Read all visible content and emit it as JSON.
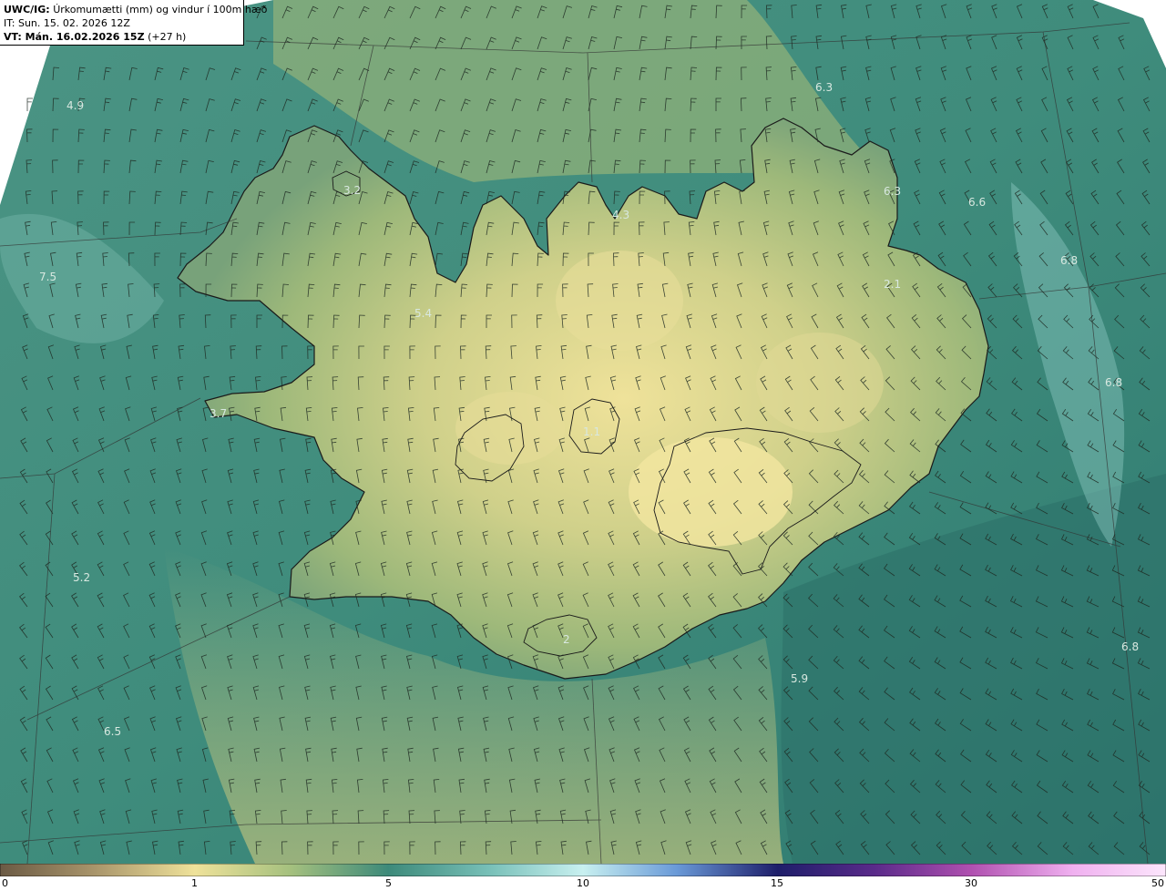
{
  "header": {
    "product_code": "UWC/IG:",
    "product_name": "Úrkomumætti (mm) og vindur í 100m hæð",
    "init_time": "IT: Sun. 15. 02. 2026 12Z",
    "valid_label": "VT: Mán. 16.02.2026 15Z",
    "valid_offset": "(+27 h)"
  },
  "colors": {
    "low": "#6b5a44",
    "tan": "#c8b87a",
    "yellow": "#efe29a",
    "green_mid": "#a0b878",
    "teal": "#3d8a7a",
    "teal_dark": "#2c6f68",
    "cyan_light": "#c8f0f0",
    "navy": "#2a2a8a",
    "purple": "#6a2a8a",
    "magenta": "#c060c0",
    "pink": "#f0b0f0"
  },
  "colorbar": {
    "ticks": [
      "0",
      "1",
      "5",
      "10",
      "15",
      "30",
      "50"
    ]
  },
  "value_labels": [
    "4.9",
    "3.2",
    "7.5",
    "5.4",
    "4.3",
    "3.7",
    "6.3",
    "6.3",
    "6.6",
    "6.8",
    "2.1",
    "6.8",
    "1.1",
    "5.2",
    "2",
    "6.5",
    "5.9",
    "6.8"
  ]
}
